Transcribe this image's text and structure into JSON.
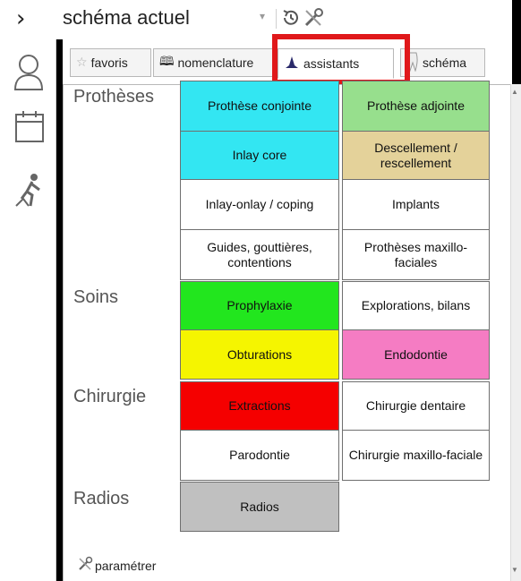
{
  "rail": {
    "expand_glyph": "›",
    "icons": [
      "chevron-right-icon",
      "user-icon",
      "calendar-icon",
      "worker-icon"
    ]
  },
  "topbar": {
    "title": "schéma actuel",
    "dropdown_glyph": "▾",
    "icons": [
      "history-icon",
      "tools-icon"
    ]
  },
  "tabs": [
    {
      "label": "favoris",
      "icon": "star-icon",
      "active": false
    },
    {
      "label": "nomenclature",
      "icon": "book-icon",
      "active": false
    },
    {
      "label": "assistants",
      "icon": "wizard-hat-icon",
      "active": true
    },
    {
      "label": "schéma",
      "icon": "tooth-icon",
      "active": false
    }
  ],
  "categories": {
    "protheses": "Prothèses",
    "soins": "Soins",
    "chirurgie": "Chirurgie",
    "radios": "Radios"
  },
  "buttons": {
    "prothese_conjointe": {
      "label": "Prothèse conjointe",
      "color": "#33e6f2"
    },
    "prothese_adjointe": {
      "label": "Prothèse adjointe",
      "color": "#97df8d"
    },
    "inlay_core": {
      "label": "Inlay core",
      "color": "#33e6f2"
    },
    "descellement": {
      "label": "Descellement / rescellement",
      "color": "#e4d29a"
    },
    "inlay_onlay": {
      "label": "Inlay-onlay / coping",
      "color": "#ffffff"
    },
    "implants": {
      "label": "Implants",
      "color": "#ffffff"
    },
    "guides": {
      "label": "Guides, gouttières, contentions",
      "color": "#ffffff"
    },
    "protheses_maxillo": {
      "label": "Prothèses maxillo-faciales",
      "color": "#ffffff"
    },
    "prophylaxie": {
      "label": "Prophylaxie",
      "color": "#22e61e"
    },
    "explorations": {
      "label": "Explorations, bilans",
      "color": "#ffffff"
    },
    "obturations": {
      "label": "Obturations",
      "color": "#f5f500"
    },
    "endodontie": {
      "label": "Endodontie",
      "color": "#f57cc3"
    },
    "extractions": {
      "label": "Extractions",
      "color": "#f50000"
    },
    "chirurgie_dentaire": {
      "label": "Chirurgie dentaire",
      "color": "#ffffff"
    },
    "parodontie": {
      "label": "Parodontie",
      "color": "#ffffff"
    },
    "chirurgie_maxillo": {
      "label": "Chirurgie maxillo-faciale",
      "color": "#ffffff"
    },
    "radios": {
      "label": "Radios",
      "color": "#c0c0c0"
    }
  },
  "footer": {
    "parametrer_label": "paramétrer",
    "icon": "tools-icon"
  }
}
